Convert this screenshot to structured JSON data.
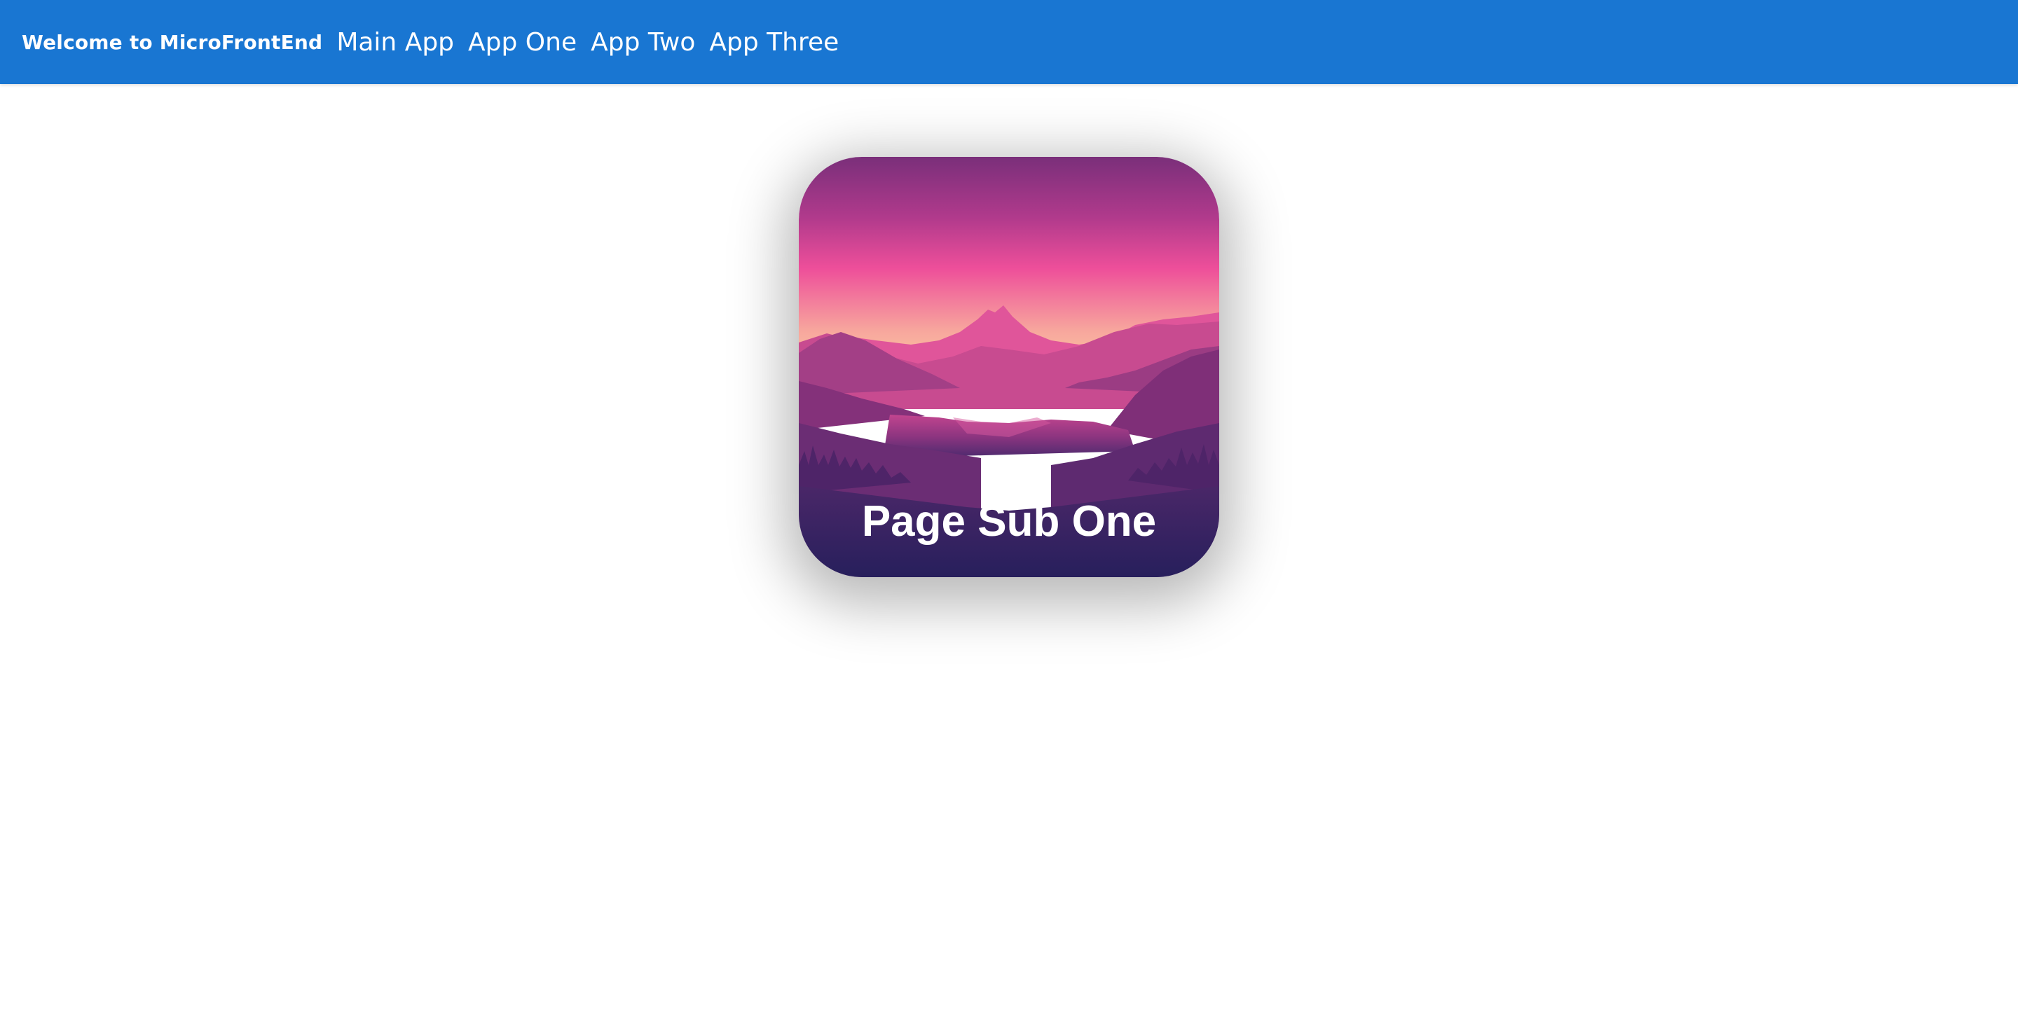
{
  "header": {
    "brand": "Welcome to MicroFrontEnd",
    "nav": [
      {
        "label": "Main App"
      },
      {
        "label": "App One"
      },
      {
        "label": "App Two"
      },
      {
        "label": "App Three"
      }
    ],
    "background_color": "#1976d2"
  },
  "card": {
    "title": "Page Sub One",
    "image": "purple-mountain-lake-landscape"
  }
}
